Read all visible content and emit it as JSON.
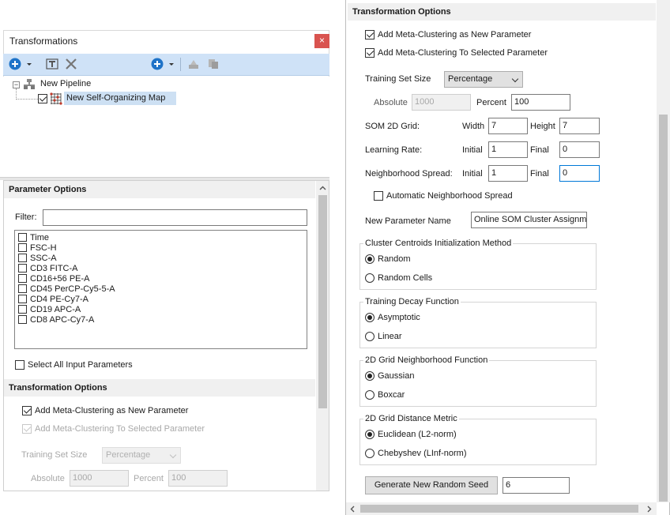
{
  "transformations_panel": {
    "title": "Transformations",
    "close_glyph": "×",
    "tree": {
      "root": "New Pipeline",
      "child": "New Self-Organizing Map"
    }
  },
  "parameter_options": {
    "header": "Parameter Options",
    "filter_label": "Filter:",
    "filter_value": "",
    "parameters": [
      "Time",
      "FSC-H",
      "SSC-A",
      "CD3 FITC-A",
      "CD16+56 PE-A",
      "CD45 PerCP-Cy5-5-A",
      "CD4 PE-Cy7-A",
      "CD19 APC-A",
      "CD8 APC-Cy7-A"
    ],
    "select_all_label": "Select All Input Parameters"
  },
  "left_transformation_options": {
    "header": "Transformation Options",
    "add_meta_new_label": "Add Meta-Clustering as New Parameter",
    "add_meta_selected_label": "Add Meta-Clustering To Selected Parameter",
    "training_set_size_label": "Training Set Size",
    "training_set_size_value": "Percentage",
    "absolute_label": "Absolute",
    "absolute_value": "1000",
    "percent_label": "Percent",
    "percent_value": "100"
  },
  "right_options": {
    "header": "Transformation Options",
    "add_meta_new_label": "Add Meta-Clustering as New Parameter",
    "add_meta_selected_label": "Add Meta-Clustering To Selected Parameter",
    "training_set_size_label": "Training Set Size",
    "training_set_size_value": "Percentage",
    "absolute_label": "Absolute",
    "absolute_value": "1000",
    "percent_label": "Percent",
    "percent_value": "100",
    "som_grid_label": "SOM 2D Grid:",
    "width_label": "Width",
    "width_value": "7",
    "height_label": "Height",
    "height_value": "7",
    "learning_rate_label": "Learning Rate:",
    "lr_initial_label": "Initial",
    "lr_initial_value": "1",
    "lr_final_label": "Final",
    "lr_final_value": "0",
    "neighborhood_label": "Neighborhood Spread:",
    "ns_initial_label": "Initial",
    "ns_initial_value": "1",
    "ns_final_label": "Final",
    "ns_final_value": "0",
    "auto_spread_label": "Automatic Neighborhood Spread",
    "new_param_name_label": "New Parameter Name",
    "new_param_name_value": "Online SOM Cluster Assignment",
    "centroids_group": {
      "title": "Cluster Centroids Initialization Method",
      "options": [
        "Random",
        "Random Cells"
      ]
    },
    "decay_group": {
      "title": "Training Decay Function",
      "options": [
        "Asymptotic",
        "Linear"
      ]
    },
    "neighborhood_group": {
      "title": "2D Grid Neighborhood Function",
      "options": [
        "Gaussian",
        "Boxcar"
      ]
    },
    "distance_group": {
      "title": "2D Grid Distance Metric",
      "options": [
        "Euclidean (L2-norm)",
        "Chebyshev (LInf-norm)"
      ]
    },
    "seed_button_label": "Generate New Random Seed",
    "seed_value": "6"
  },
  "colors": {
    "toolbar_bg": "#cfe2f7",
    "close_button": "#d9534f",
    "accent": "#1e73c8",
    "selection": "#cde0f3"
  }
}
